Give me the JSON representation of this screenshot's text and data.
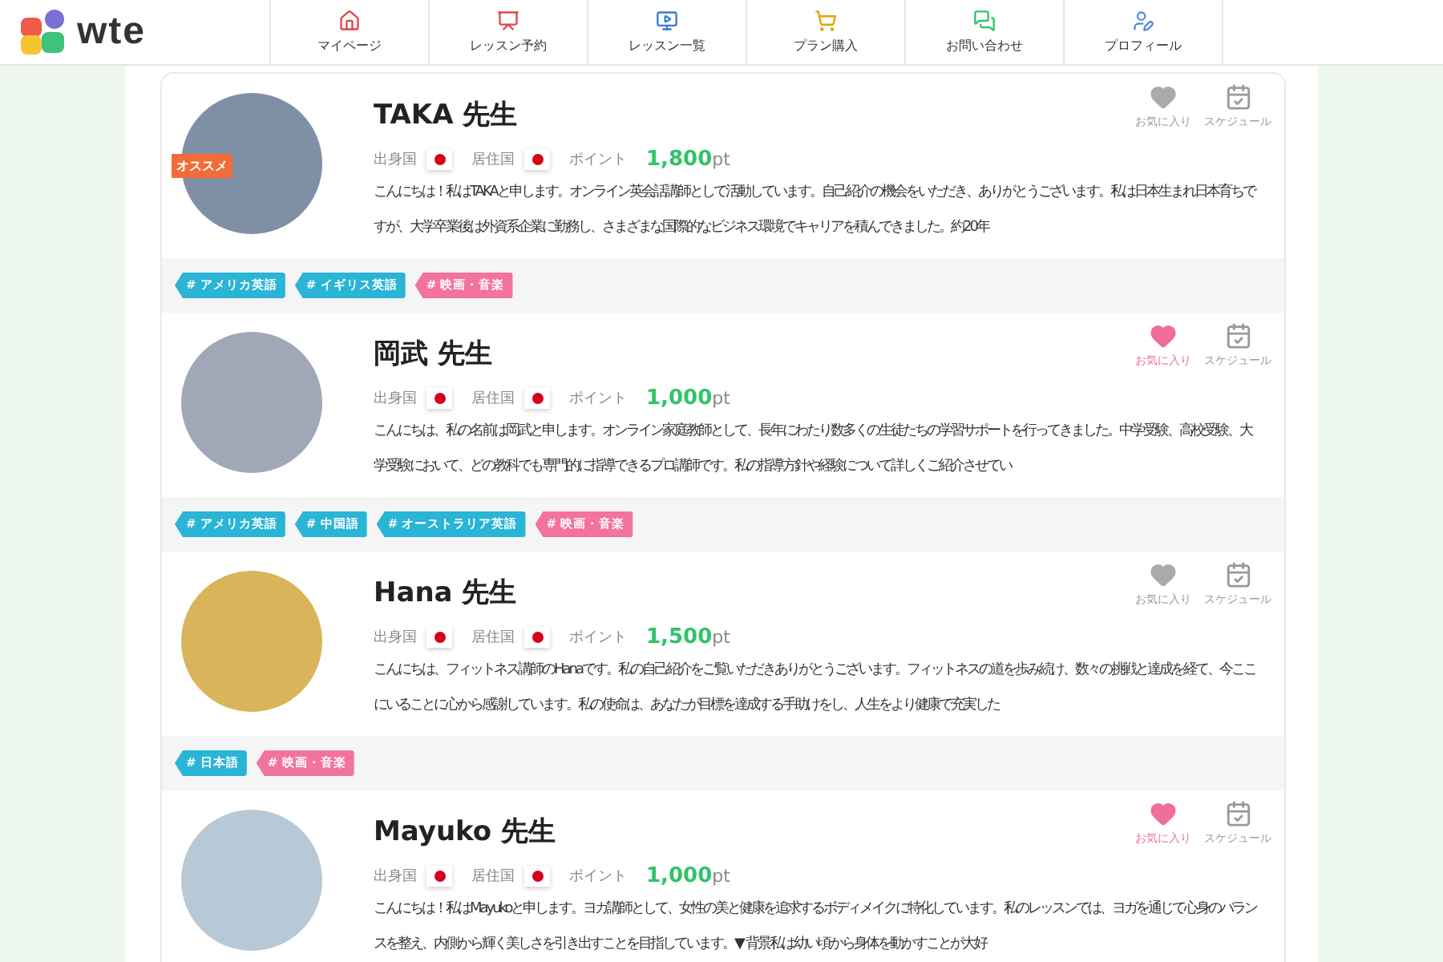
{
  "logo": {
    "text": "wte"
  },
  "nav": [
    {
      "label": "マイページ"
    },
    {
      "label": "レッスン予約"
    },
    {
      "label": "レッスン一覧"
    },
    {
      "label": "プラン購入"
    },
    {
      "label": "お問い合わせ"
    },
    {
      "label": "プロフィール"
    }
  ],
  "teachers": [
    {
      "name": "TAKA 先生",
      "recommended": true,
      "badge": "オススメ",
      "origin_label": "出身国",
      "residence_label": "居住国",
      "points_label": "ポイント",
      "points": "1,800",
      "points_unit": "pt",
      "favorite": {
        "label": "お気に入り",
        "selected": false
      },
      "schedule": {
        "label": "スケジュール"
      },
      "intro": "こんにちは！私はTAKAと申します。オンライン英会話講師として活動しています。自己紹介の機会をいただき、ありがとうございます。私は日本生まれ日本育ちですが、大学卒業後は外資系企業に勤務し、さまざまな国際的なビジネス環境でキャリアを積んできました。約20年",
      "tags": [
        {
          "label": "# アメリカ英語",
          "color": "#2ab4d6"
        },
        {
          "label": "# イギリス英語",
          "color": "#2ab4d6"
        },
        {
          "label": "# 映画・音楽",
          "color": "#f2739b"
        }
      ]
    },
    {
      "name": "岡武 先生",
      "recommended": false,
      "origin_label": "出身国",
      "residence_label": "居住国",
      "points_label": "ポイント",
      "points": "1,000",
      "points_unit": "pt",
      "favorite": {
        "label": "お気に入り",
        "selected": true
      },
      "schedule": {
        "label": "スケジュール"
      },
      "intro": "こんにちは、私の名前は岡武と申します。オンライン家庭教師として、長年にわたり数多くの生徒たちの学習サポートを行ってきました。中学受験、高校受験、大学受験において、どの教科でも専門的に指導できるプロ講師です。私の指導方針や経験について詳しくご紹介させてい",
      "tags": [
        {
          "label": "# アメリカ英語",
          "color": "#2ab4d6"
        },
        {
          "label": "# 中国語",
          "color": "#2ab4d6"
        },
        {
          "label": "# オーストラリア英語",
          "color": "#2ab4d6"
        },
        {
          "label": "# 映画・音楽",
          "color": "#f2739b"
        }
      ]
    },
    {
      "name": "Hana 先生",
      "recommended": false,
      "origin_label": "出身国",
      "residence_label": "居住国",
      "points_label": "ポイント",
      "points": "1,500",
      "points_unit": "pt",
      "favorite": {
        "label": "お気に入り",
        "selected": false
      },
      "schedule": {
        "label": "スケジュール"
      },
      "intro": "こんにちは、フィットネス講師のHanaです。私の自己紹介をご覧いただきありがとうございます。フィットネスの道を歩み続け、数々の挑戦と達成を経て、今ここにいることに心から感謝しています。私の使命は、あなたが目標を達成する手助けをし、人生をより健康で充実した",
      "tags": [
        {
          "label": "# 日本語",
          "color": "#2ab4d6"
        },
        {
          "label": "# 映画・音楽",
          "color": "#f2739b"
        }
      ]
    },
    {
      "name": "Mayuko 先生",
      "recommended": false,
      "origin_label": "出身国",
      "residence_label": "居住国",
      "points_label": "ポイント",
      "points": "1,000",
      "points_unit": "pt",
      "favorite": {
        "label": "お気に入り",
        "selected": true
      },
      "schedule": {
        "label": "スケジュール"
      },
      "intro": "こんにちは！私はMayukoと申します。ヨガ講師として、女性の美と健康を追求するボディメイクに特化しています。私のレッスンでは、ヨガを通じて心身のバランスを整え、内側から輝く美しさを引き出すことを目指しています。▼ 背景私は幼い頃から身体を動かすことが大好"
    }
  ]
}
